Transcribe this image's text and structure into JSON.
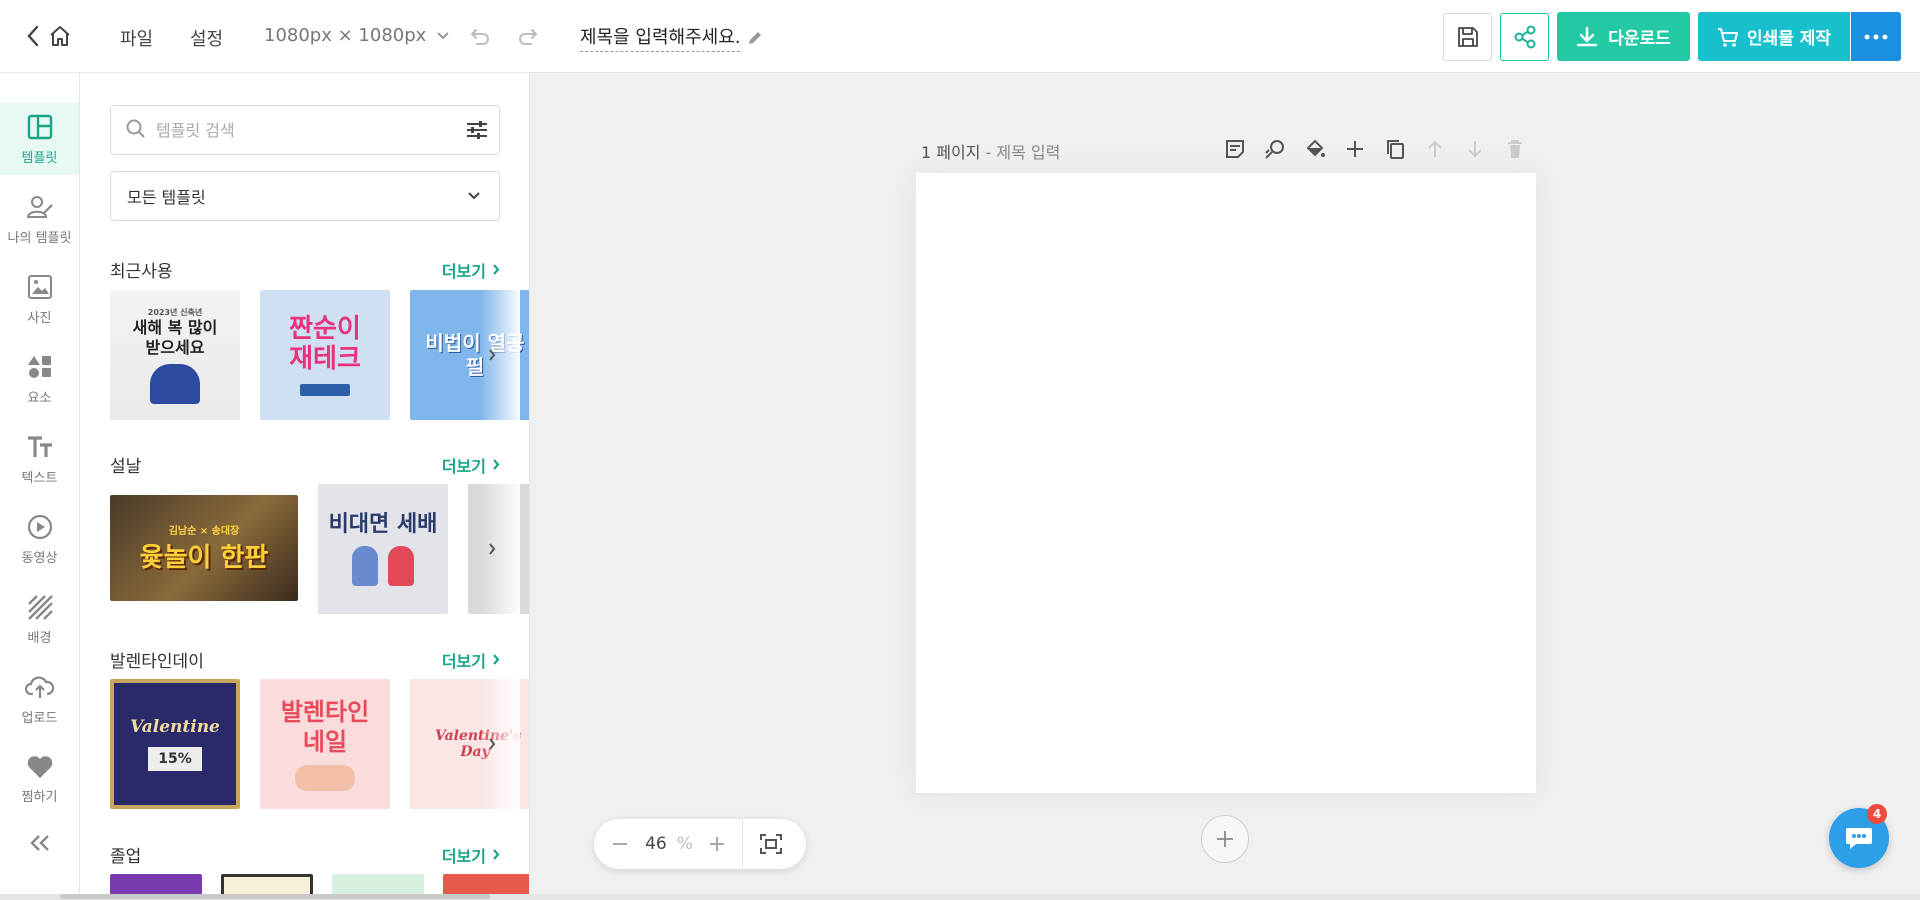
{
  "topbar": {
    "menu_file": "파일",
    "menu_settings": "설정",
    "canvas_size": "1080px × 1080px",
    "document_title": "제목을 입력해주세요.",
    "download_label": "다운로드",
    "print_label": "인쇄물 제작"
  },
  "sidenav": {
    "items": [
      {
        "label": "템플릿",
        "icon": "layout-icon",
        "active": true
      },
      {
        "label": "나의 템플릿",
        "icon": "my-template-icon"
      },
      {
        "label": "사진",
        "icon": "image-icon"
      },
      {
        "label": "요소",
        "icon": "shapes-icon"
      },
      {
        "label": "텍스트",
        "icon": "text-icon"
      },
      {
        "label": "동영상",
        "icon": "play-icon"
      },
      {
        "label": "배경",
        "icon": "background-icon"
      },
      {
        "label": "업로드",
        "icon": "cloud-upload-icon"
      },
      {
        "label": "찜하기",
        "icon": "heart-icon"
      }
    ]
  },
  "panel": {
    "search_placeholder": "템플릿 검색",
    "dropdown_value": "모든 템플릿",
    "more_label": "더보기",
    "sections": [
      {
        "title": "최근사용",
        "thumbs": [
          {
            "caption": "새해 복 많이 받으세요",
            "top": "2023년 신축년"
          },
          {
            "caption": "짠순이 재테크",
            "top": ""
          },
          {
            "caption": "비법이 열공필",
            "top": ""
          }
        ]
      },
      {
        "title": "설날",
        "thumbs": [
          {
            "caption": "윷놀이 한판",
            "top": "김남순 × 송대장"
          },
          {
            "caption": "비대면 세배",
            "top": ""
          },
          {
            "caption": "",
            "top": ""
          }
        ]
      },
      {
        "title": "발렌타인데이",
        "thumbs": [
          {
            "caption": "Valentine",
            "top": "15%"
          },
          {
            "caption": "발렌타인 네일",
            "top": ""
          },
          {
            "caption": "Valentine's Day",
            "top": ""
          }
        ]
      },
      {
        "title": "졸업",
        "thumbs": []
      }
    ]
  },
  "editor": {
    "page_number": "1 페이지",
    "page_title_placeholder": "- 제목 입력",
    "zoom_value": "46",
    "zoom_unit": "%"
  },
  "chat": {
    "badge_count": "4"
  },
  "colors": {
    "accent": "#23c9a5",
    "print": "#18bfcc",
    "more": "#1d8fe0"
  }
}
